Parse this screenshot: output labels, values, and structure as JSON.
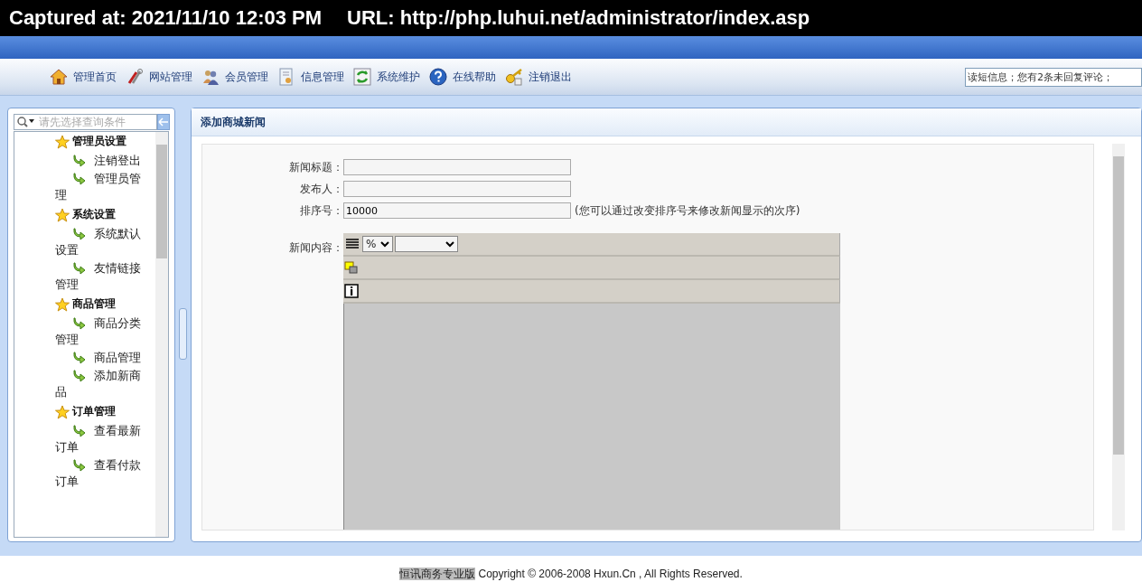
{
  "capture_header": {
    "captured": "Captured at: 2021/11/10 12:03 PM",
    "url": "URL: http://php.luhui.net/administrator/index.asp"
  },
  "toolbar": {
    "items": [
      {
        "label": "管理首页"
      },
      {
        "label": "网站管理"
      },
      {
        "label": "会员管理"
      },
      {
        "label": "信息管理"
      },
      {
        "label": "系统维护"
      },
      {
        "label": "在线帮助"
      },
      {
        "label": "注销退出"
      }
    ],
    "notice": "读短信息；您有2条未回复评论；"
  },
  "sidebar": {
    "search": {
      "placeholder": "请先选择查询条件"
    },
    "tree": [
      {
        "label": "管理员设置",
        "children": [
          {
            "label": "注销登出"
          },
          {
            "label": "管理员管理"
          }
        ]
      },
      {
        "label": "系统设置",
        "children": [
          {
            "label": "系统默认设置"
          },
          {
            "label": "友情链接管理"
          }
        ]
      },
      {
        "label": "商品管理",
        "children": [
          {
            "label": "商品分类管理"
          },
          {
            "label": "商品管理"
          },
          {
            "label": "添加新商品"
          }
        ]
      },
      {
        "label": "订单管理",
        "children": [
          {
            "label": "查看最新订单"
          },
          {
            "label": "查看付款订单"
          }
        ]
      }
    ]
  },
  "main": {
    "title": "添加商城新闻",
    "fields": [
      {
        "label": "新闻标题："
      },
      {
        "label": "发布人："
      },
      {
        "label": "排序号：",
        "value": "10000",
        "hint": "(您可以通过改变排序号来修改新闻显示的次序)"
      }
    ],
    "content_label": "新闻内容：",
    "editor": {
      "rows": [
        {
          "kind": "format",
          "zoom": "%"
        },
        {
          "kind": "layer"
        },
        {
          "kind": "info"
        }
      ]
    }
  },
  "footer": {
    "brand": "恒讯商务专业版",
    "copyright": "Copyright © 2006-2008 Hxun.Cn , All Rights Reserved."
  }
}
